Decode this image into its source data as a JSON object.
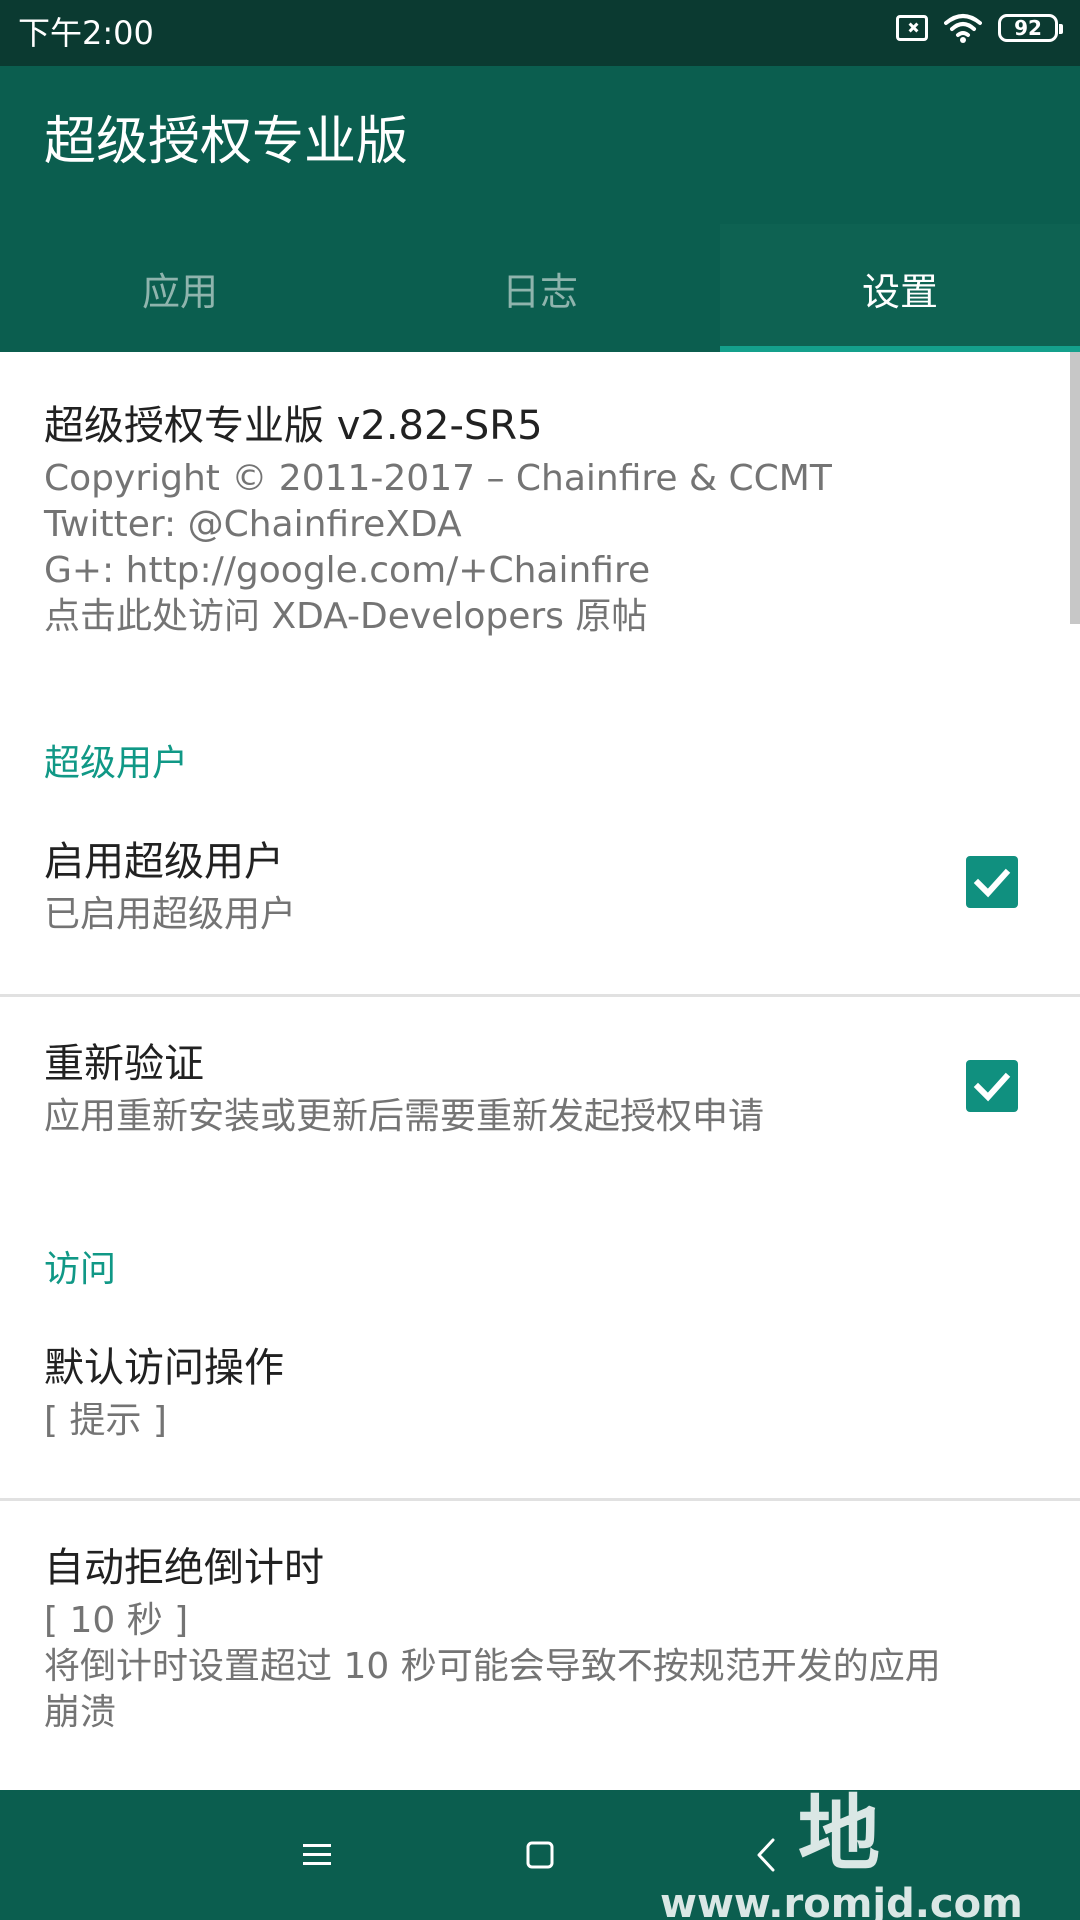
{
  "status_bar": {
    "time": "下午2:00",
    "battery": "92",
    "icons": [
      "sim-off-icon",
      "wifi-icon",
      "battery-icon"
    ]
  },
  "app_bar": {
    "title": "超级授权专业版"
  },
  "tabs": [
    {
      "label": "应用",
      "selected": false
    },
    {
      "label": "日志",
      "selected": false
    },
    {
      "label": "设置",
      "selected": true
    }
  ],
  "about": {
    "title": "超级授权专业版 v2.82-SR5",
    "lines": [
      "Copyright © 2011-2017 – Chainfire & CCMT",
      "Twitter: @ChainfireXDA",
      "G+: http://google.com/+Chainfire",
      "点击此处访问 XDA-Developers 原帖"
    ]
  },
  "sections": {
    "superuser": {
      "header": "超级用户",
      "enable": {
        "title": "启用超级用户",
        "summary": "已启用超级用户",
        "checked": true
      },
      "reauth": {
        "title": "重新验证",
        "summary": "应用重新安装或更新后需要重新发起授权申请",
        "checked": true
      }
    },
    "access": {
      "header": "访问",
      "default_action": {
        "title": "默认访问操作",
        "value": "[ 提示 ]"
      },
      "auto_deny": {
        "title": "自动拒绝倒计时",
        "value": "[ 10 秒 ]",
        "summary_line1": "将倒计时设置超过 10 秒可能会导致不按规范开发的应用",
        "summary_line2": "崩溃"
      }
    }
  },
  "nav_bar": {
    "buttons": [
      "menu-icon",
      "home-icon",
      "back-icon"
    ]
  },
  "watermark": {
    "main": "ROM基地",
    "sub": "www.romjd.com"
  },
  "colors": {
    "status_bar": "#0b3a31",
    "app_bar": "#0b5e4f",
    "accent": "#14a08c",
    "checkbox": "#10907f"
  }
}
